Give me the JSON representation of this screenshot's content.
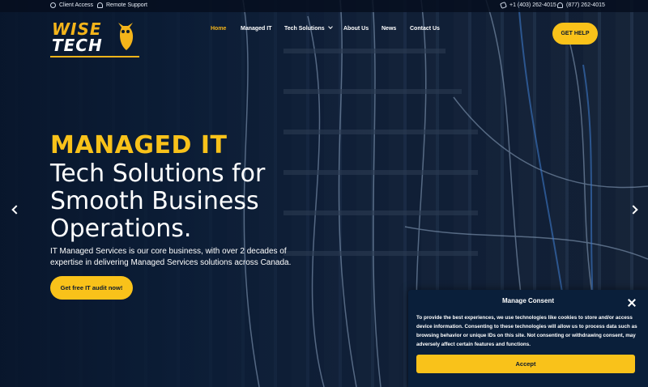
{
  "topbar": {
    "client_access": "Client Access",
    "remote_support": "Remote Support",
    "phone_local": "+1 (403) 262-4015",
    "phone_toll": "(877) 262-4015"
  },
  "logo": {
    "line1": "WISE",
    "line2": "TECH"
  },
  "nav": {
    "items": [
      {
        "label": "Home"
      },
      {
        "label": "Managed IT"
      },
      {
        "label": "Tech Solutions"
      },
      {
        "label": "About Us"
      },
      {
        "label": "News"
      },
      {
        "label": "Contact Us"
      }
    ]
  },
  "header": {
    "help_label": "GET HELP"
  },
  "hero": {
    "accent": "MANAGED IT",
    "title_line1": "Tech Solutions for",
    "title_line2": "Smooth Business",
    "title_line3": "Operations.",
    "subtitle": "IT Managed Services is our core business, with over 2 decades of expertise in delivering Managed Services solutions across Canada.",
    "cta_label": "Get free IT audit now!"
  },
  "consent": {
    "title": "Manage Consent",
    "body": "To provide the best experiences, we use technologies like cookies to store and/or access device information. Consenting to these technologies will allow us to process data such as browsing behavior or unique IDs on this site. Not consenting or withdrawing consent, may adversely affect certain features and functions.",
    "accept_label": "Accept"
  },
  "colors": {
    "accent": "#f9c21a",
    "navy": "#0c1a2e",
    "white": "#ffffff"
  }
}
